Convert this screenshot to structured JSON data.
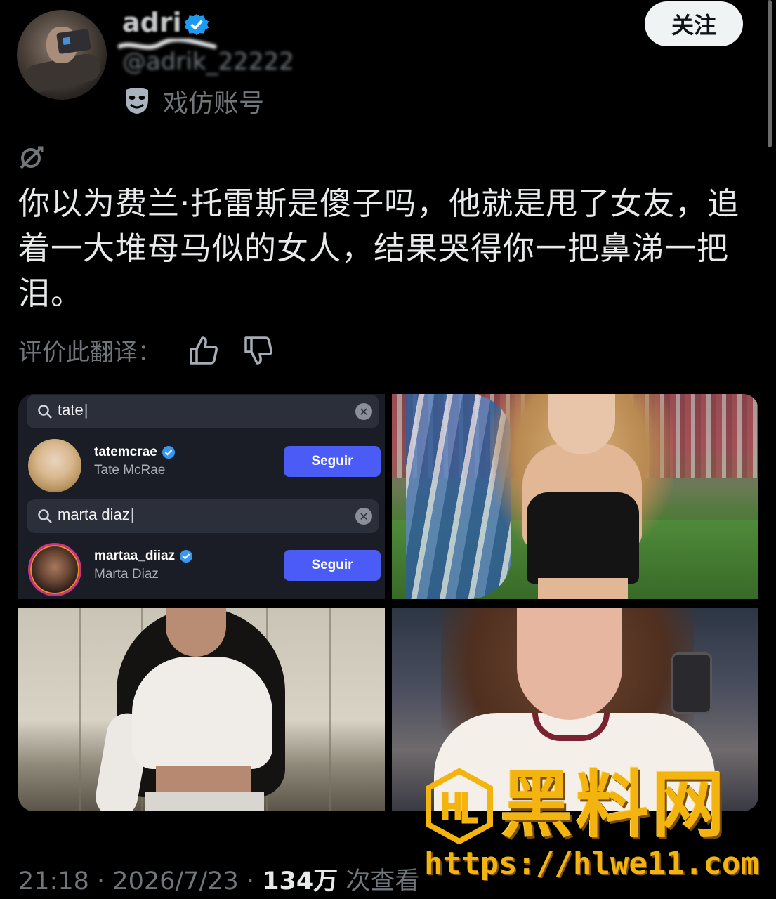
{
  "header": {
    "display_name": "adri",
    "handle": "@adrik_22222",
    "parody_label": "戏仿账号",
    "follow_label": "关注"
  },
  "tweet": {
    "text": "你以为费兰·托雷斯是傻子吗，他就是甩了女友，追着一大堆母马似的女人，结果哭得你一把鼻涕一把泪。",
    "rate_translation_label": "评价此翻译："
  },
  "media": {
    "search_ui": {
      "query_1": "tate",
      "result_1": {
        "username": "tatemcrae",
        "full_name": "Tate McRae",
        "button": "Seguir"
      },
      "query_2": "marta diaz",
      "result_2": {
        "username": "martaa_diiaz",
        "full_name": "Marta Diaz",
        "button": "Seguir"
      }
    }
  },
  "watermark": {
    "brand": "黑料网",
    "url": "https://hlwe11.com"
  },
  "footer": {
    "time": "21:18",
    "date": "2026/7/23",
    "views_count": "134万",
    "views_label": "次查看",
    "separator": "·"
  },
  "colors": {
    "background": "#000000",
    "text_primary": "#e7e9ea",
    "text_secondary": "#71767b",
    "verified": "#1d9bf0",
    "seguir_button": "#4a5cf5",
    "watermark": "#f4b40f"
  },
  "icons": [
    "verified-badge-icon",
    "parody-mask-icon",
    "translate-icon",
    "thumbs-up-icon",
    "thumbs-down-icon",
    "search-icon",
    "clear-icon"
  ]
}
